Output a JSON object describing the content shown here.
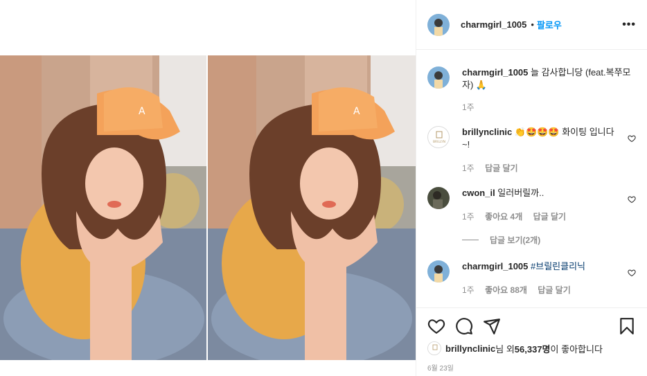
{
  "post": {
    "username": "charmgirl_1005",
    "separator": "•",
    "follow_label": "팔로우",
    "more_label": "•••"
  },
  "caption": {
    "username": "charmgirl_1005",
    "text": " 늘 감사합니당 (feat.복쭈모자) 🙏",
    "time": "1주"
  },
  "comments": [
    {
      "username": "brillynclinic",
      "text": " 👏🤩🤩🤩 화이팅 입니다~!",
      "time": "1주",
      "reply_label": "답글 달기",
      "logo_text": "BRILLYN"
    },
    {
      "username": "cwon_il",
      "text": " 일러버릴까..",
      "time": "1주",
      "likes_label": "좋아요 4개",
      "reply_label": "답글 달기",
      "view_replies_label": "답글 보기(2개)"
    },
    {
      "username": "charmgirl_1005",
      "text": " #브릴린클리닉",
      "time": "1주",
      "likes_label": "좋아요 88개",
      "reply_label": "답글 달기"
    }
  ],
  "likes": {
    "username": "brillynclinic",
    "suffix": "님 외 ",
    "count": "56,337명",
    "tail": "이 좋아합니다"
  },
  "date": "6월 23일",
  "icons": {
    "like": "heart-icon",
    "comment": "comment-icon",
    "share": "share-icon",
    "save": "bookmark-icon",
    "more": "more-icon"
  },
  "colors": {
    "accent": "#0095f6",
    "muted": "#8e8e8e",
    "text": "#262626",
    "border": "#efefef"
  }
}
